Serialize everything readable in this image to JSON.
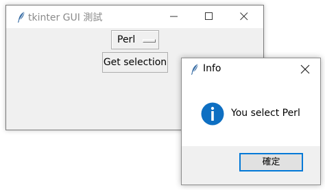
{
  "main_window": {
    "title": "tkinter GUI 測試",
    "icon": "feather-icon",
    "controls": {
      "minimize": "minimize-icon",
      "maximize": "maximize-icon",
      "close": "close-icon"
    },
    "option_menu": {
      "selected": "Perl"
    },
    "get_button_label": "Get selection"
  },
  "info_dialog": {
    "title": "Info",
    "icon": "feather-icon",
    "close_icon": "close-icon",
    "message_icon": "info-icon",
    "message": "You select Perl",
    "ok_label": "確定"
  },
  "colors": {
    "window_bg": "#f0f0f0",
    "titlebar_bg": "#ffffff",
    "info_blue": "#0e6fc2",
    "focus_blue": "#0078d7"
  }
}
